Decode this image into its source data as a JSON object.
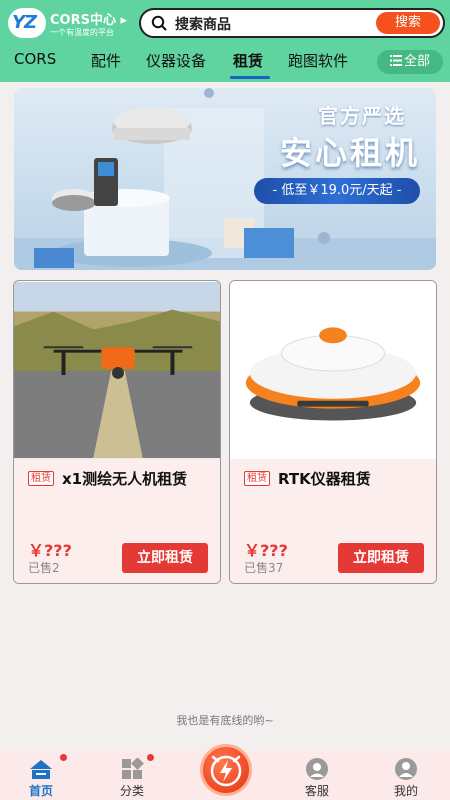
{
  "header": {
    "logo_mark": "YZ",
    "logo_title": "CORS中心 ▸",
    "logo_subtitle": "一个有温度的平台",
    "search_placeholder": "搜索商品",
    "search_button": "搜索"
  },
  "tabs": [
    {
      "label": "CORS",
      "active": false
    },
    {
      "label": "配件",
      "active": false
    },
    {
      "label": "仪器设备",
      "active": false
    },
    {
      "label": "租赁",
      "active": true
    },
    {
      "label": "跑图软件",
      "active": false
    }
  ],
  "all_button": "全部",
  "banner": {
    "title_line1": "官方严选",
    "title_line2": "安心租机",
    "pill_text": "- 低至￥19.0元/天起 -"
  },
  "products": [
    {
      "tag": "租赁",
      "title": "x1测绘无人机租赁",
      "price": "￥???",
      "sold": "已售2",
      "button": "立即租赁"
    },
    {
      "tag": "租赁",
      "title": "RTK仪器租赁",
      "price": "￥???",
      "sold": "已售37",
      "button": "立即租赁"
    }
  ],
  "footer_note": "我也是有底线的哟~",
  "bottom_nav": [
    {
      "label": "首页",
      "icon": "home-icon",
      "active": true
    },
    {
      "label": "分类",
      "icon": "category-icon",
      "active": false
    },
    {
      "label": "客服",
      "icon": "customer-service-icon",
      "active": false
    },
    {
      "label": "我的",
      "icon": "profile-icon",
      "active": false
    }
  ],
  "colors": {
    "header_bg": "#5fd3a0",
    "accent_red": "#e53935",
    "search_button": "#f4511e",
    "active_tab_underline": "#1565c0"
  }
}
